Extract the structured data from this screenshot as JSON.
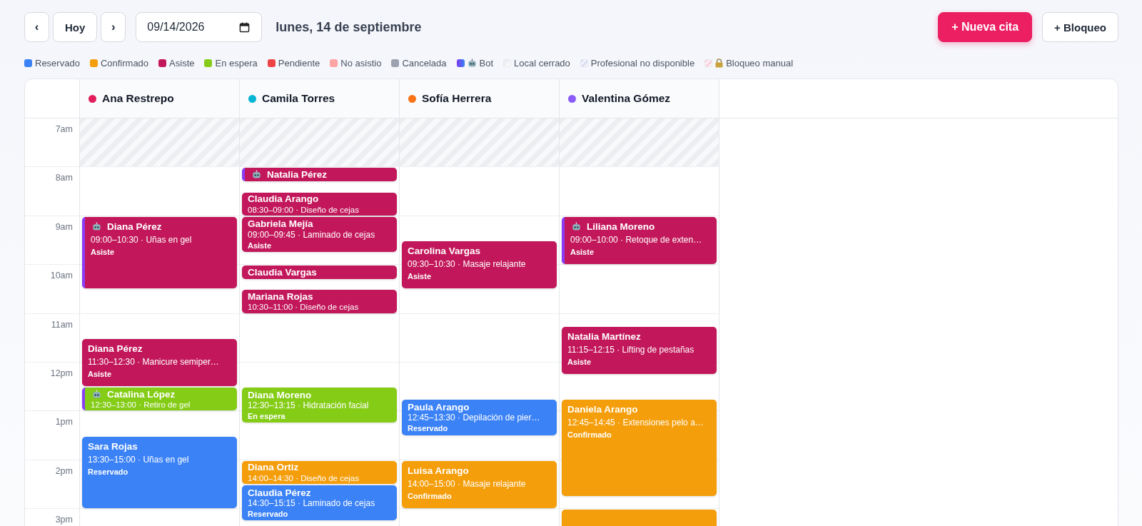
{
  "toolbar": {
    "prev": "‹",
    "today": "Hoy",
    "next": "›",
    "date": "09/14/2026",
    "heading": "lunes, 14 de septiembre",
    "new_button": "+ Nueva cita",
    "block_button": "+ Bloqueo"
  },
  "legend": [
    {
      "kind": "status",
      "label": "Reservado",
      "color": "#3b82f6"
    },
    {
      "kind": "status",
      "label": "Confirmado",
      "color": "#f59e0b"
    },
    {
      "kind": "status",
      "label": "Asiste",
      "color": "#c2185b"
    },
    {
      "kind": "status",
      "label": "En espera",
      "color": "#84cc16"
    },
    {
      "kind": "status",
      "label": "Pendiente",
      "color": "#ef4444"
    },
    {
      "kind": "status",
      "label": "No asistio",
      "color": "#fca5a5"
    },
    {
      "kind": "status",
      "label": "Cancelada",
      "color": "#9ca3af"
    },
    {
      "kind": "bot",
      "label": "Bot"
    },
    {
      "kind": "closed",
      "label": "Local cerrado"
    },
    {
      "kind": "unavailable",
      "label": "Profesional no disponible"
    },
    {
      "kind": "manual",
      "label": "Bloqueo manual"
    }
  ],
  "hours": [
    "7am",
    "8am",
    "9am",
    "10am",
    "11am",
    "12pm",
    "1pm",
    "2pm",
    "3pm"
  ],
  "professionals": [
    {
      "name": "Ana Restrepo",
      "color": "#e11d5c",
      "rows": [
        {
          "kind": "closed"
        },
        {
          "kind": "open"
        },
        {
          "kind": "open",
          "appointments": [
            {
              "color": "#c2185b",
              "bot": true,
              "client": "Diana Pérez",
              "detail": "09:00–10:30 · Uñas en gel",
              "status": "Asiste"
            }
          ]
        },
        {
          "kind": "open"
        },
        {
          "kind": "open",
          "appointments": [
            {
              "color": "#c2185b",
              "bot": false,
              "client": "Diana Pérez",
              "detail": "11:30–12:30 · Manicure semiper…",
              "status": "Asiste"
            }
          ]
        },
        {
          "kind": "open",
          "appointments": [
            {
              "color": "#84cc16",
              "bot": true,
              "client": "Catalina López",
              "detail": "12:30–13:00 · Retiro de gel"
            }
          ]
        },
        {
          "kind": "open",
          "appointments": [
            {
              "color": "#3b82f6",
              "bot": false,
              "client": "Sara Rojas",
              "detail": "13:30–15:00 · Uñas en gel",
              "status": "Reservado"
            }
          ]
        },
        {
          "kind": "open"
        },
        {
          "kind": "open"
        }
      ]
    },
    {
      "name": "Camila Torres",
      "color": "#06b6d4",
      "rows": [
        {
          "kind": "closed"
        },
        {
          "kind": "open",
          "appointments": [
            {
              "color": "#c2185b",
              "bot": true,
              "client": "Natalia Pérez"
            },
            {
              "color": "#c2185b",
              "bot": false,
              "client": "Claudia Arango",
              "detail": "08:30–09:00 · Diseño de cejas"
            }
          ]
        },
        {
          "kind": "open",
          "appointments": [
            {
              "color": "#c2185b",
              "bot": false,
              "client": "Gabriela Mejía",
              "detail": "09:00–09:45 · Laminado de cejas",
              "status": "Asiste"
            }
          ]
        },
        {
          "kind": "open",
          "appointments": [
            {
              "color": "#c2185b",
              "bot": false,
              "client": "Claudia Vargas"
            },
            {
              "color": "#c2185b",
              "bot": false,
              "client": "Mariana Rojas",
              "detail": "10:30–11:00 · Diseño de cejas"
            }
          ]
        },
        {
          "kind": "open"
        },
        {
          "kind": "open",
          "appointments": [
            {
              "color": "#84cc16",
              "bot": false,
              "client": "Diana Moreno",
              "detail": "12:30–13:15 · Hidratación facial",
              "status": "En espera"
            }
          ]
        },
        {
          "kind": "open"
        },
        {
          "kind": "open",
          "appointments": [
            {
              "color": "#f59e0b",
              "bot": false,
              "client": "Diana Ortiz",
              "detail": "14:00–14:30 · Diseño de cejas"
            },
            {
              "color": "#3b82f6",
              "bot": false,
              "client": "Claudia Pérez",
              "detail": "14:30–15:15 · Laminado de cejas",
              "status": "Reservado"
            }
          ]
        },
        {
          "kind": "open"
        }
      ]
    },
    {
      "name": "Sofía Herrera",
      "color": "#f97316",
      "rows": [
        {
          "kind": "closed"
        },
        {
          "kind": "open"
        },
        {
          "kind": "open",
          "appointments": [
            {
              "color": "#c2185b",
              "bot": false,
              "client": "Carolina Vargas",
              "detail": "09:30–10:30 · Masaje relajante",
              "status": "Asiste"
            }
          ]
        },
        {
          "kind": "open"
        },
        {
          "kind": "open"
        },
        {
          "kind": "open",
          "appointments": [
            {
              "color": "#3b82f6",
              "bot": false,
              "client": "Paula Arango",
              "detail": "12:45–13:30 · Depilación de pier…",
              "status": "Reservado"
            }
          ]
        },
        {
          "kind": "open"
        },
        {
          "kind": "open",
          "appointments": [
            {
              "color": "#f59e0b",
              "bot": false,
              "client": "Luisa Arango",
              "detail": "14:00–15:00 · Masaje relajante",
              "status": "Confirmado"
            }
          ]
        },
        {
          "kind": "open"
        }
      ]
    },
    {
      "name": "Valentina Gómez",
      "color": "#8b5cf6",
      "rows": [
        {
          "kind": "closed"
        },
        {
          "kind": "open"
        },
        {
          "kind": "open",
          "appointments": [
            {
              "color": "#c2185b",
              "bot": true,
              "client": "Liliana Moreno",
              "detail": "09:00–10:00 · Retoque de exten…",
              "status": "Asiste"
            }
          ]
        },
        {
          "kind": "open"
        },
        {
          "kind": "open",
          "appointments": [
            {
              "color": "#c2185b",
              "bot": false,
              "client": "Natalia Martínez",
              "detail": "11:15–12:15 · Lifting de pestañas",
              "status": "Asiste"
            }
          ]
        },
        {
          "kind": "open",
          "appointments": [
            {
              "color": "#f59e0b",
              "bot": false,
              "client": "Daniela Arango",
              "detail": "12:45–14:45 · Extensiones pelo a…",
              "status": "Confirmado"
            }
          ]
        },
        {
          "kind": "open"
        },
        {
          "kind": "open"
        },
        {
          "kind": "open",
          "appointments": [
            {
              "color": "#f59e0b",
              "bot": false
            }
          ]
        }
      ]
    }
  ]
}
